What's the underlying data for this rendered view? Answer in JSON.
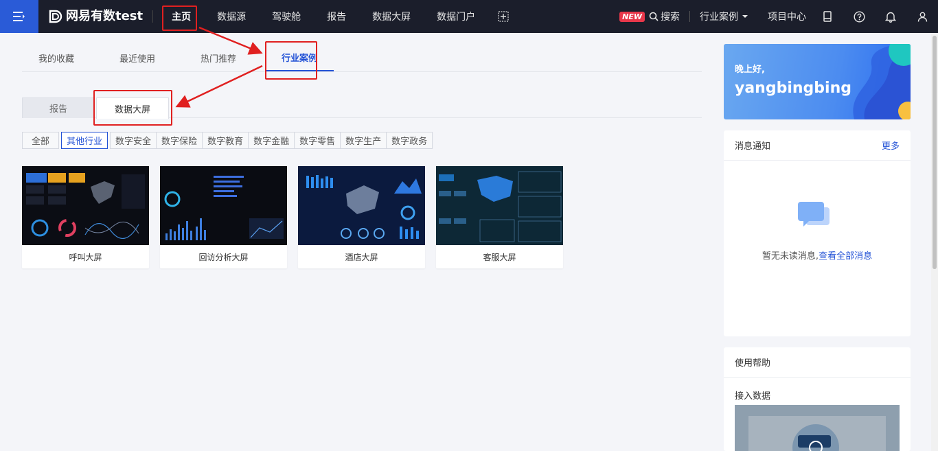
{
  "topbar": {
    "brand": "网易有数test",
    "nav": [
      {
        "label": "主页",
        "active": true
      },
      {
        "label": "数据源"
      },
      {
        "label": "驾驶舱"
      },
      {
        "label": "报告"
      },
      {
        "label": "数据大屏"
      },
      {
        "label": "数据门户"
      }
    ],
    "new_badge": "NEW",
    "search_label": "搜索",
    "industry_label": "行业案例",
    "project_label": "项目中心"
  },
  "main_tabs": [
    {
      "label": "我的收藏"
    },
    {
      "label": "最近使用"
    },
    {
      "label": "热门推荐"
    },
    {
      "label": "行业案例",
      "active": true
    }
  ],
  "sub_tabs": [
    {
      "label": "报告"
    },
    {
      "label": "数据大屏",
      "active": true
    }
  ],
  "filters": [
    "全部",
    "其他行业",
    "数字安全",
    "数字保险",
    "数字教育",
    "数字金融",
    "数字零售",
    "数字生产",
    "数字政务"
  ],
  "active_filter": "其他行业",
  "cards": [
    {
      "title": "呼叫大屏"
    },
    {
      "title": "回访分析大屏"
    },
    {
      "title": "酒店大屏"
    },
    {
      "title": "客服大屏"
    }
  ],
  "greeting": {
    "hello": "晚上好,",
    "name": "yangbingbing"
  },
  "messages": {
    "title": "消息通知",
    "more": "更多",
    "empty_text": "暂无未读消息,",
    "view_all": "查看全部消息"
  },
  "help": {
    "title": "使用帮助",
    "item": "接入数据"
  },
  "colors": {
    "accent": "#2352d6",
    "topbar": "#1b1e2b",
    "highlight": "#e02020"
  }
}
